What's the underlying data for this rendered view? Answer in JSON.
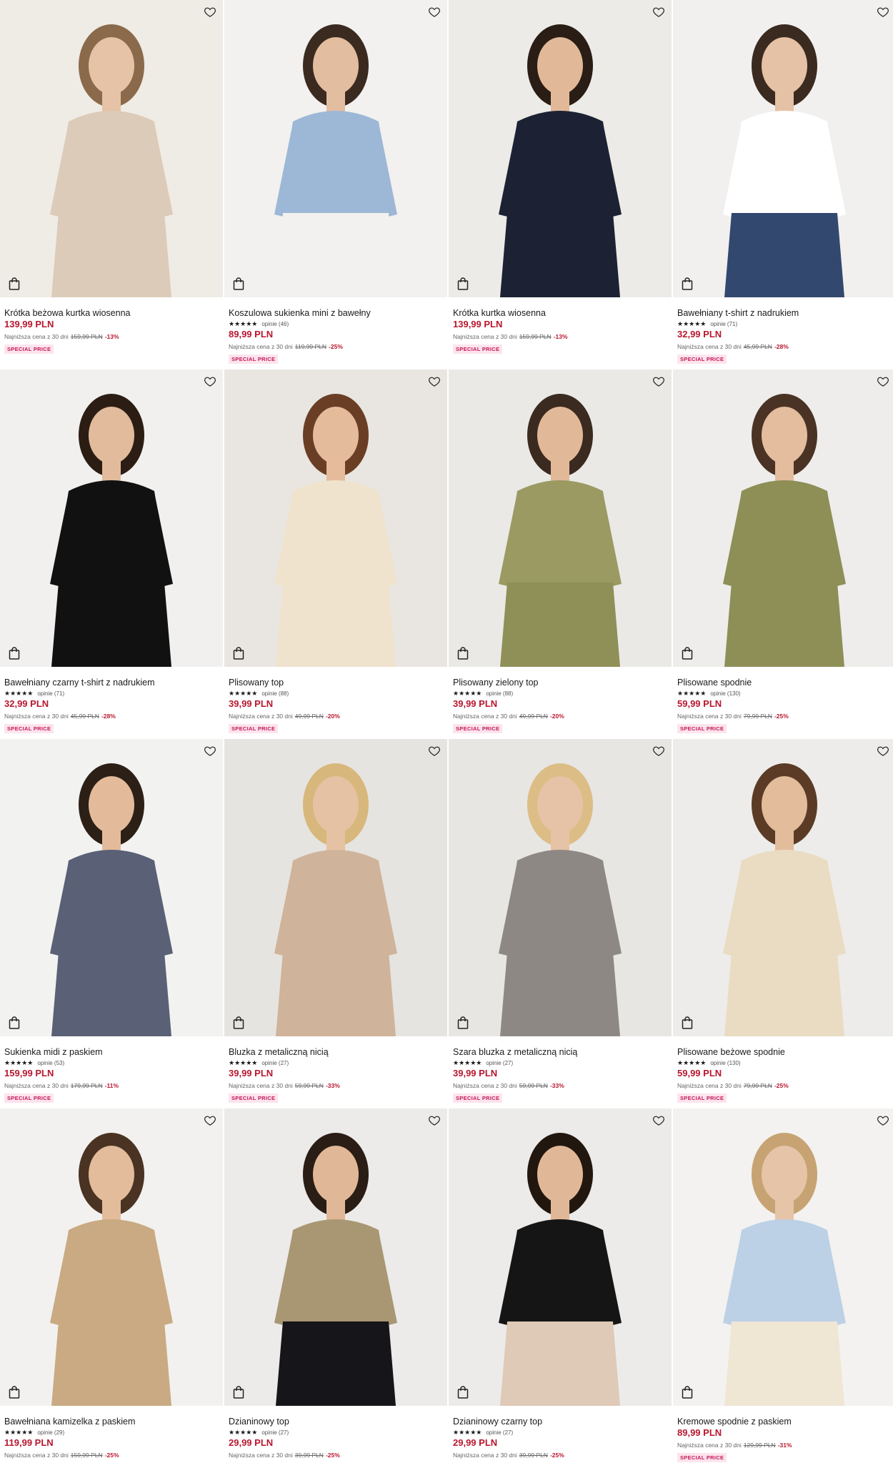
{
  "colors": {
    "price": "#b8172f",
    "badge_bg": "#fde4ec",
    "badge_text": "#c2185b"
  },
  "icons": {
    "wishlist": "heart-icon",
    "add_to_bag": "shopping-bag-icon"
  },
  "products": [
    {
      "name": "Krótka beżowa kurtka wiosenna",
      "stars": "",
      "reviews": "",
      "price": "139,99 PLN",
      "lowest_label": "Najniższa cena z 30 dni",
      "old_price": "159,99 PLN",
      "discount": "-13%",
      "badge": "SPECIAL PRICE",
      "rating_value": null,
      "bg": "#efebe5",
      "cloth": "#dccbb8",
      "skin": "#e6c2a6",
      "hair": "#8a6a4a",
      "bottom": "#dccbb8"
    },
    {
      "name": "Koszulowa sukienka mini z bawełny",
      "stars": "★★★★★",
      "reviews": "opinie (46)",
      "price": "89,99 PLN",
      "lowest_label": "Najniższa cena z 30 dni",
      "old_price": "119,99 PLN",
      "discount": "-25%",
      "badge": "SPECIAL PRICE",
      "rating_value": 4.5,
      "bg": "#f2f1ef",
      "cloth": "#9db8d6",
      "skin": "#e3bd9f",
      "hair": "#3b2a1f",
      "bottom": "#f2f1ef"
    },
    {
      "name": "Krótka kurtka wiosenna",
      "stars": "",
      "reviews": "",
      "price": "139,99 PLN",
      "lowest_label": "Najniższa cena z 30 dni",
      "old_price": "159,99 PLN",
      "discount": "-13%",
      "badge": "SPECIAL PRICE",
      "rating_value": null,
      "bg": "#ecebe8",
      "cloth": "#1c2233",
      "skin": "#e2b998",
      "hair": "#2a1d15",
      "bottom": "#1c2233"
    },
    {
      "name": "Bawełniany t-shirt z nadrukiem",
      "stars": "★★★★★",
      "reviews": "opinie (71)",
      "price": "32,99 PLN",
      "lowest_label": "Najniższa cena z 30 dni",
      "old_price": "45,99 PLN",
      "discount": "-28%",
      "badge": "SPECIAL PRICE",
      "rating_value": 5,
      "bg": "#f1f0ee",
      "cloth": "#ffffff",
      "skin": "#e5c1a5",
      "hair": "#3a2a20",
      "bottom": "#33486e"
    },
    {
      "name": "Bawełniany czarny t-shirt z nadrukiem",
      "stars": "★★★★★",
      "reviews": "opinie (71)",
      "price": "32,99 PLN",
      "lowest_label": "Najniższa cena z 30 dni",
      "old_price": "45,99 PLN",
      "discount": "-28%",
      "badge": "SPECIAL PRICE",
      "rating_value": 5,
      "bg": "#f1f0ee",
      "cloth": "#111111",
      "skin": "#e2bb9c",
      "hair": "#2b1d14",
      "bottom": "#111111"
    },
    {
      "name": "Plisowany top",
      "stars": "★★★★★",
      "reviews": "opinie (88)",
      "price": "39,99 PLN",
      "lowest_label": "Najniższa cena z 30 dni",
      "old_price": "49,99 PLN",
      "discount": "-20%",
      "badge": "SPECIAL PRICE",
      "rating_value": 4.5,
      "bg": "#e9e6e1",
      "cloth": "#efe3cd",
      "skin": "#e4bc9c",
      "hair": "#6a3e25",
      "bottom": "#efe3cd"
    },
    {
      "name": "Plisowany zielony top",
      "stars": "★★★★★",
      "reviews": "opinie (88)",
      "price": "39,99 PLN",
      "lowest_label": "Najniższa cena z 30 dni",
      "old_price": "49,99 PLN",
      "discount": "-20%",
      "badge": "SPECIAL PRICE",
      "rating_value": 4.5,
      "bg": "#ebe9e6",
      "cloth": "#9a9a62",
      "skin": "#e2b998",
      "hair": "#3b2a20",
      "bottom": "#8f8f58"
    },
    {
      "name": "Plisowane spodnie",
      "stars": "★★★★★",
      "reviews": "opinie (130)",
      "price": "59,99 PLN",
      "lowest_label": "Najniższa cena z 30 dni",
      "old_price": "79,99 PLN",
      "discount": "-25%",
      "badge": "SPECIAL PRICE",
      "rating_value": 4.5,
      "bg": "#eeedeb",
      "cloth": "#8e8f57",
      "skin": "#e3bd9e",
      "hair": "#4a3324",
      "bottom": "#8e8f57"
    },
    {
      "name": "Sukienka midi z paskiem",
      "stars": "★★★★★",
      "reviews": "opinie (53)",
      "price": "159,99 PLN",
      "lowest_label": "Najniższa cena z 30 dni",
      "old_price": "179,99 PLN",
      "discount": "-11%",
      "badge": "SPECIAL PRICE",
      "rating_value": 4.5,
      "bg": "#f2f2f1",
      "cloth": "#5a6075",
      "skin": "#e3bb9b",
      "hair": "#2c1f16",
      "bottom": "#5a6075"
    },
    {
      "name": "Bluzka z metaliczną nicią",
      "stars": "★★★★★",
      "reviews": "opinie (27)",
      "price": "39,99 PLN",
      "lowest_label": "Najniższa cena z 30 dni",
      "old_price": "59,99 PLN",
      "discount": "-33%",
      "badge": "SPECIAL PRICE",
      "rating_value": 4.5,
      "bg": "#e6e4e0",
      "cloth": "#cfb39a",
      "skin": "#e6c2a4",
      "hair": "#d8b77c",
      "bottom": "#cfb39a"
    },
    {
      "name": "Szara bluzka z metaliczną nicią",
      "stars": "★★★★★",
      "reviews": "opinie (27)",
      "price": "39,99 PLN",
      "lowest_label": "Najniższa cena z 30 dni",
      "old_price": "59,99 PLN",
      "discount": "-33%",
      "badge": "SPECIAL PRICE",
      "rating_value": 4.5,
      "bg": "#e8e6e3",
      "cloth": "#8e8885",
      "skin": "#e6c3a6",
      "hair": "#dcbd86",
      "bottom": "#8e8885"
    },
    {
      "name": "Plisowane beżowe spodnie",
      "stars": "★★★★★",
      "reviews": "opinie (130)",
      "price": "59,99 PLN",
      "lowest_label": "Najniższa cena z 30 dni",
      "old_price": "79,99 PLN",
      "discount": "-25%",
      "badge": "SPECIAL PRICE",
      "rating_value": 4.5,
      "bg": "#edecea",
      "cloth": "#eadcc2",
      "skin": "#e3bc9b",
      "hair": "#5b3b26",
      "bottom": "#eadcc2"
    },
    {
      "name": "Bawełniana kamizelka z paskiem",
      "stars": "★★★★★",
      "reviews": "opinie (29)",
      "price": "119,99 PLN",
      "lowest_label": "Najniższa cena z 30 dni",
      "old_price": "159,99 PLN",
      "discount": "-25%",
      "badge": "",
      "rating_value": 4.5,
      "bg": "#f2f1ef",
      "cloth": "#c9aa82",
      "skin": "#e3bc9c",
      "hair": "#4a3322",
      "bottom": "#c9aa82"
    },
    {
      "name": "Dzianinowy top",
      "stars": "★★★★★",
      "reviews": "opinie (27)",
      "price": "29,99 PLN",
      "lowest_label": "Najniższa cena z 30 dni",
      "old_price": "39,99 PLN",
      "discount": "-25%",
      "badge": "",
      "rating_value": 4.5,
      "bg": "#ecebe9",
      "cloth": "#a99774",
      "skin": "#e1b897",
      "hair": "#2a1d15",
      "bottom": "#15151a"
    },
    {
      "name": "Dzianinowy czarny top",
      "stars": "★★★★★",
      "reviews": "opinie (27)",
      "price": "29,99 PLN",
      "lowest_label": "Najniższa cena z 30 dni",
      "old_price": "39,99 PLN",
      "discount": "-25%",
      "badge": "",
      "rating_value": 4.5,
      "bg": "#ecebe9",
      "cloth": "#151515",
      "skin": "#e1b897",
      "hair": "#22170f",
      "bottom": "#dfc9b7"
    },
    {
      "name": "Kremowe spodnie z paskiem",
      "stars": "",
      "reviews": "",
      "price": "89,99 PLN",
      "lowest_label": "Najniższa cena z 30 dni",
      "old_price": "129,99 PLN",
      "discount": "-31%",
      "badge": "SPECIAL PRICE",
      "rating_value": null,
      "bg": "#f3f2f0",
      "cloth": "#bcd0e6",
      "skin": "#e6c4a8",
      "hair": "#c7a373",
      "bottom": "#efe6d4"
    }
  ]
}
